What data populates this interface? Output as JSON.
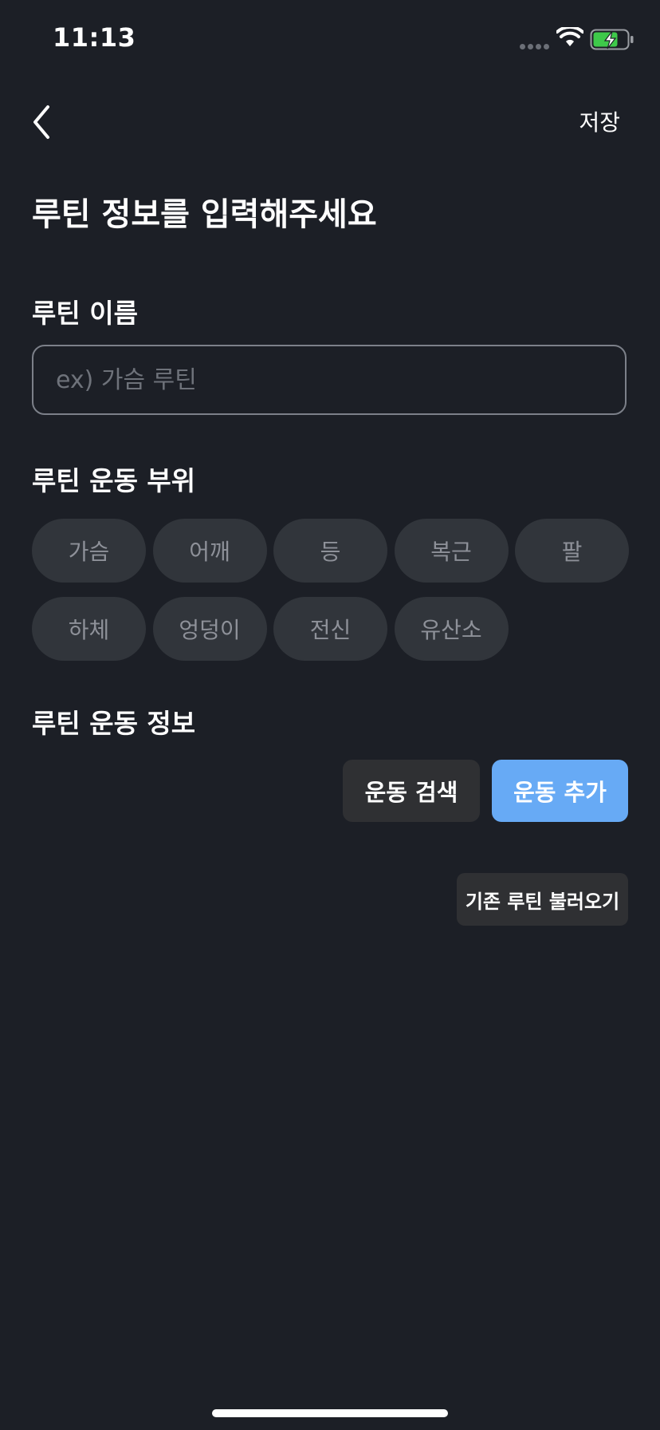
{
  "status_bar": {
    "time": "11:13",
    "battery_color": "#3ec94a"
  },
  "nav": {
    "back_icon": "chevron-left-icon",
    "save_label": "저장"
  },
  "page": {
    "title": "루틴 정보를 입력해주세요"
  },
  "routine_name": {
    "label": "루틴 이름",
    "placeholder": "ex) 가슴 루틴",
    "value": ""
  },
  "body_parts": {
    "label": "루틴 운동 부위",
    "options": [
      "가슴",
      "어깨",
      "등",
      "복근",
      "팔",
      "하체",
      "엉덩이",
      "전신",
      "유산소"
    ]
  },
  "exercise_info": {
    "label": "루틴 운동 정보",
    "search_label": "운동 검색",
    "add_label": "운동 추가",
    "load_label": "기존 루틴 불러오기"
  },
  "colors": {
    "background": "#1c1f26",
    "chip_bg": "#31353b",
    "chip_text": "#8e9199",
    "accent": "#67aaf5",
    "secondary_button": "#2f3033"
  }
}
